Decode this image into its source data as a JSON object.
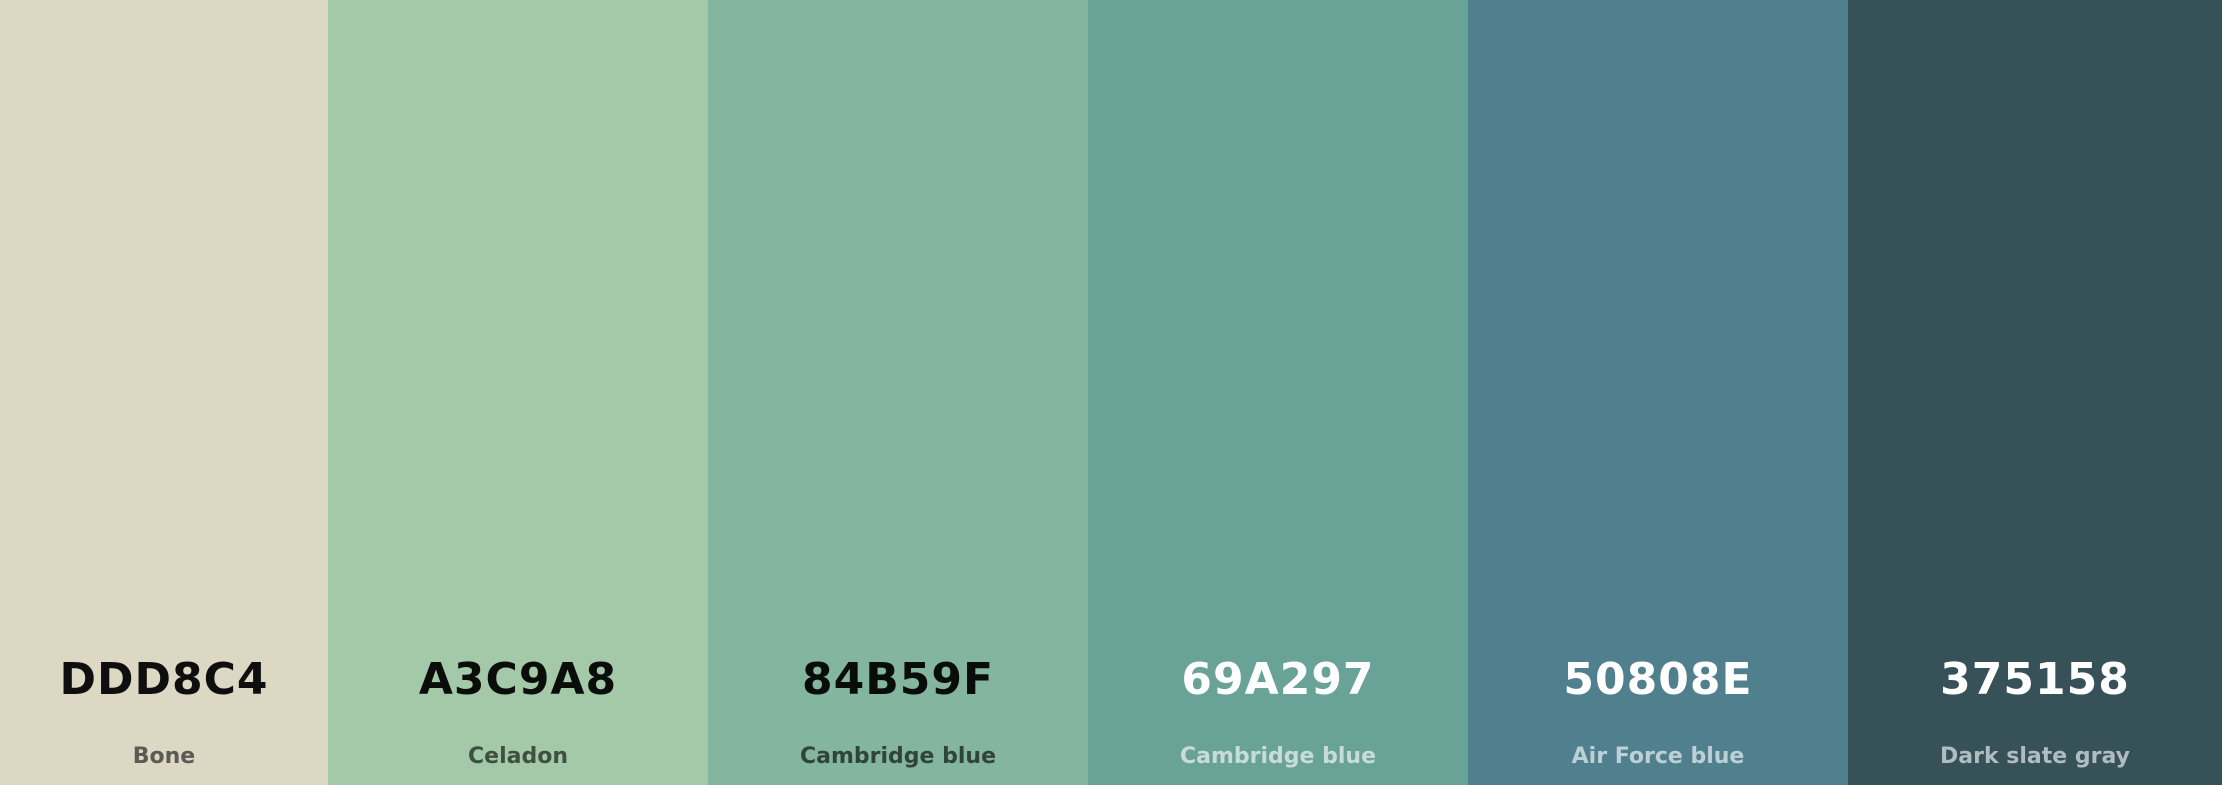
{
  "palette": {
    "swatches": [
      {
        "hex_label": "DDD8C4",
        "name": "Bone",
        "bg": "#DDD8C4",
        "hex_color": "#0E0E0E",
        "name_color": "#5B5A55"
      },
      {
        "hex_label": "A3C9A8",
        "name": "Celadon",
        "bg": "#A3C9A8",
        "hex_color": "#0A0D0A",
        "name_color": "#3F4F42"
      },
      {
        "hex_label": "84B59F",
        "name": "Cambridge blue",
        "bg": "#84B59F",
        "hex_color": "#080C0A",
        "name_color": "#2F443A"
      },
      {
        "hex_label": "69A297",
        "name": "Cambridge blue",
        "bg": "#69A297",
        "hex_color": "#FFFFFF",
        "name_color": "#C9DDD8"
      },
      {
        "hex_label": "50808E",
        "name": "Air Force blue",
        "bg": "#50808E",
        "hex_color": "#FFFFFF",
        "name_color": "#BCD0D6"
      },
      {
        "hex_label": "375158",
        "name": "Dark slate gray",
        "bg": "#375158",
        "hex_color": "#FFFFFF",
        "name_color": "#AFBCC0"
      }
    ]
  }
}
